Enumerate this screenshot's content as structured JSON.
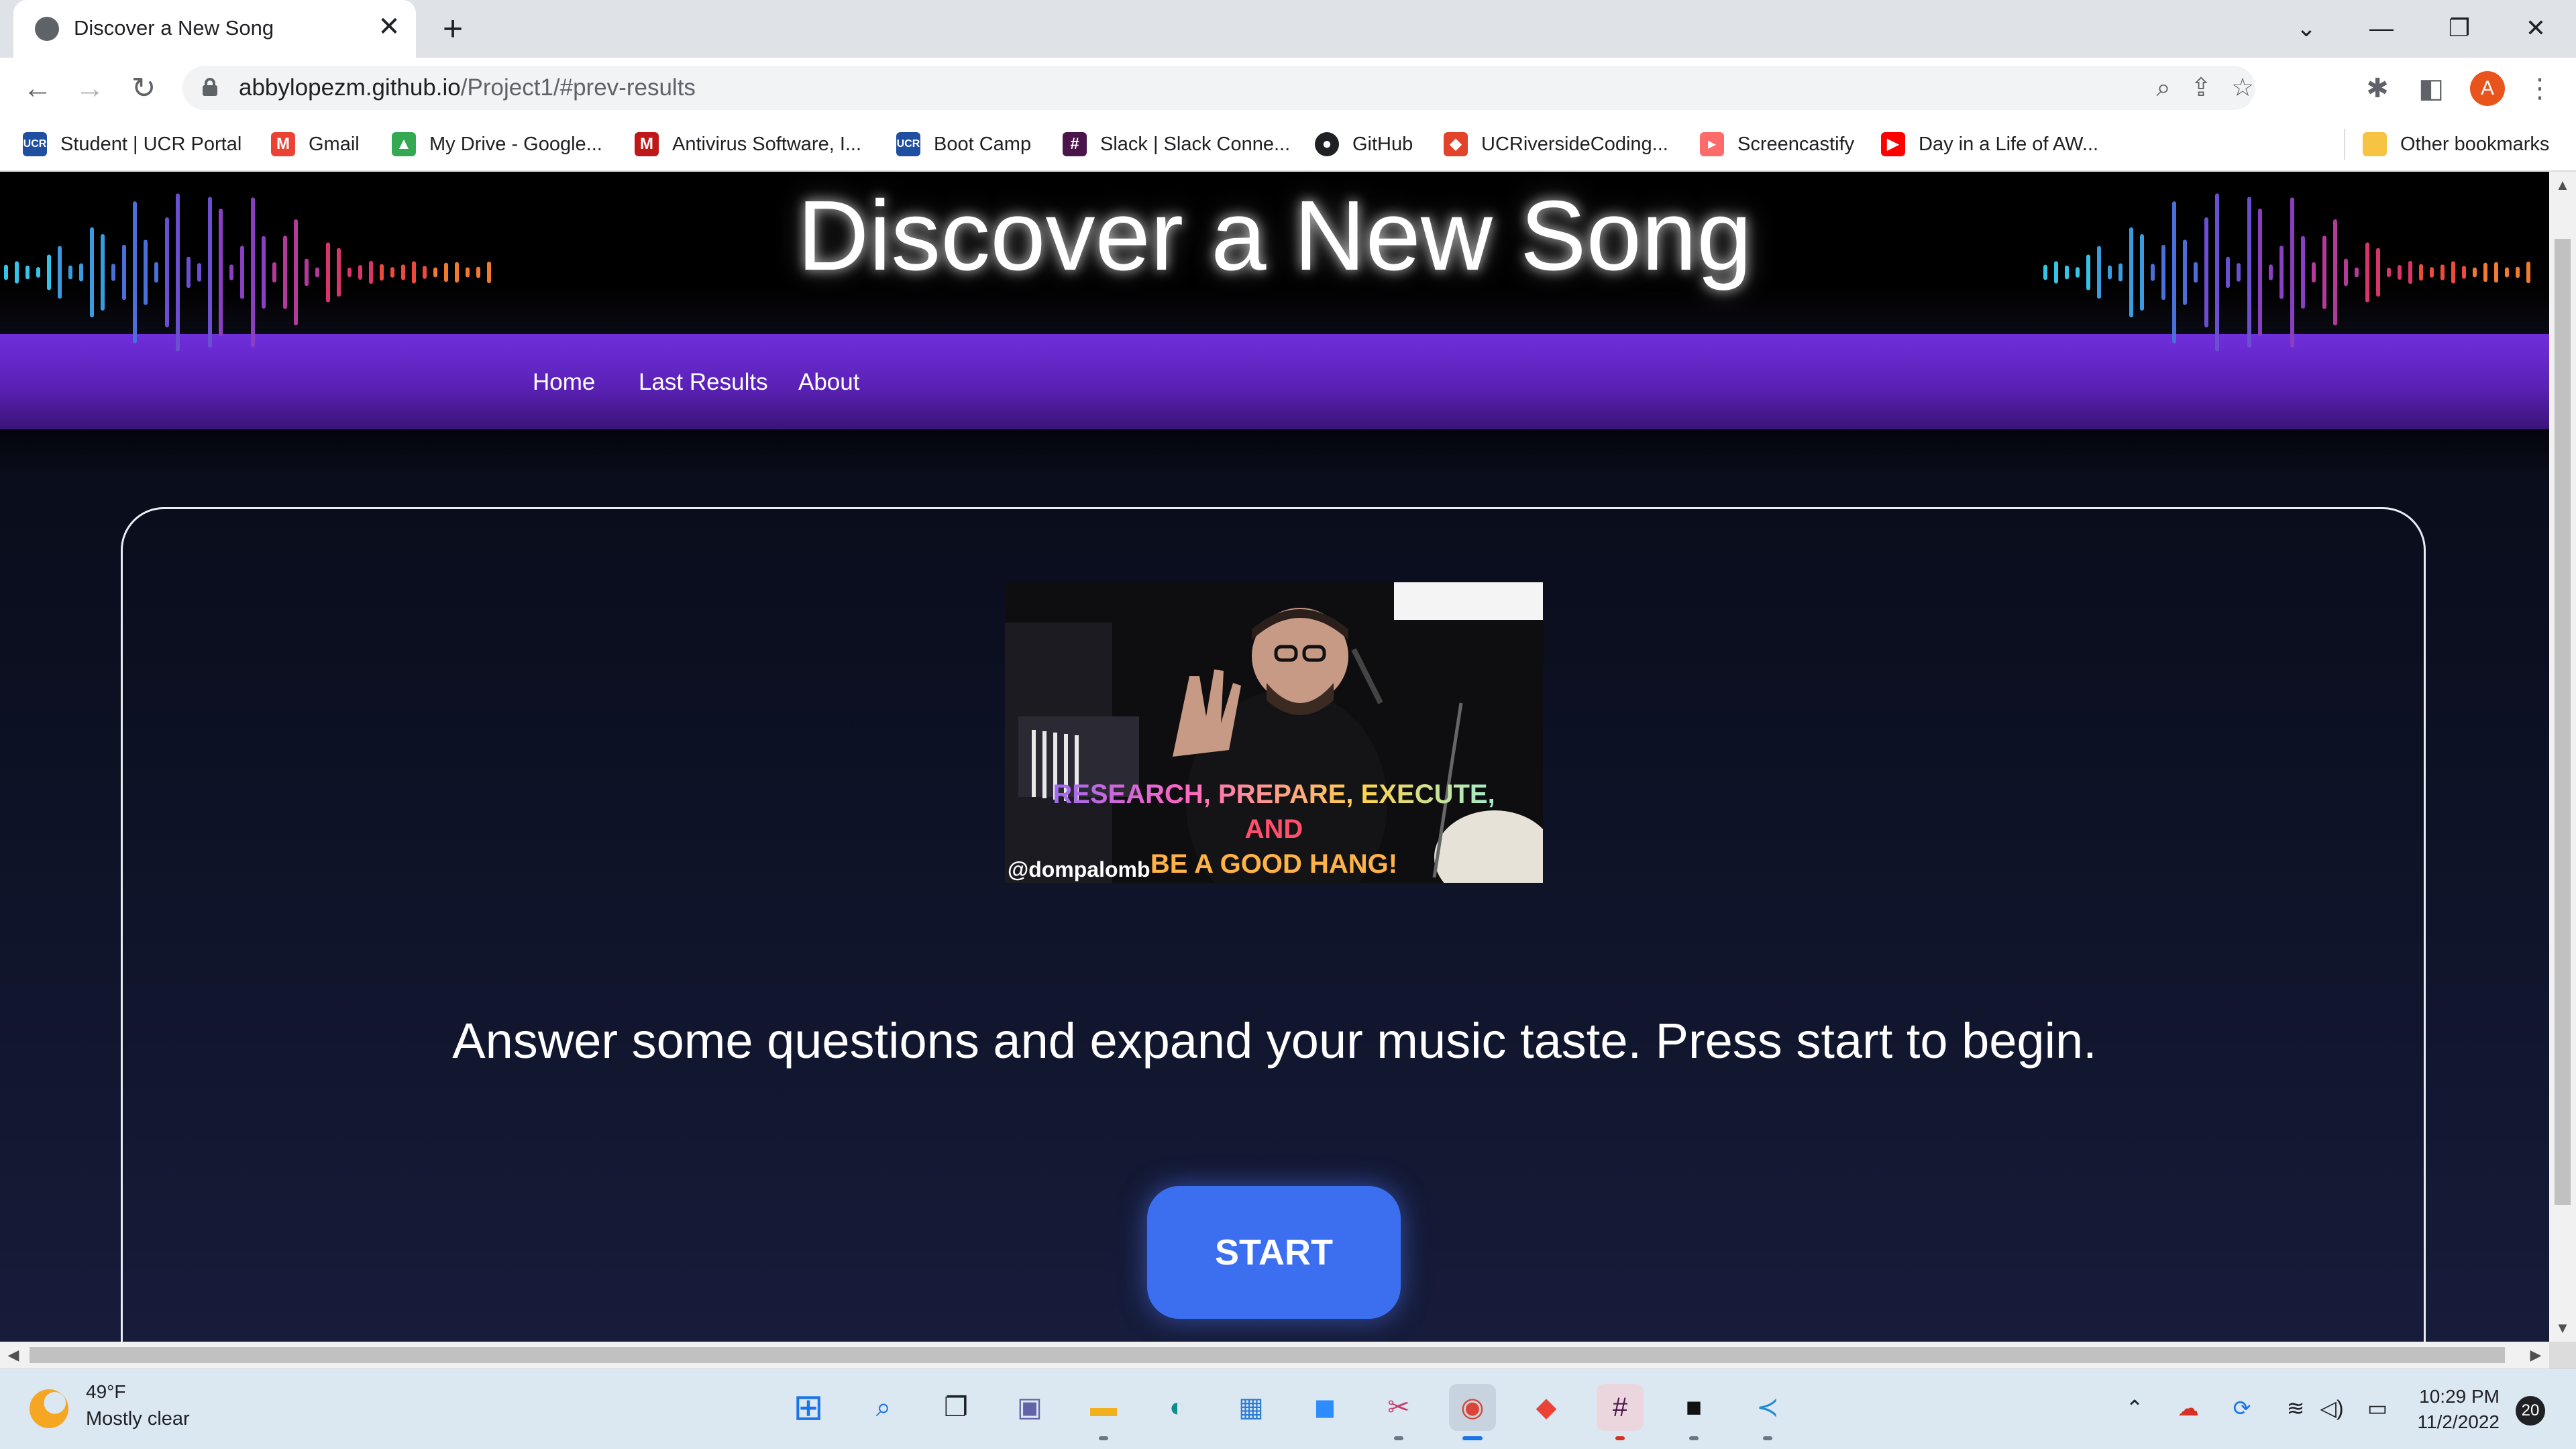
{
  "browser": {
    "tab_title": "Discover a New Song",
    "tab_close": "✕",
    "new_tab": "+",
    "url_host": "abbylopezm.github.io",
    "url_path": "/Project1/#prev-results",
    "profile_initial": "A"
  },
  "bookmarks": [
    {
      "label": "Student | UCR Portal",
      "icon": "ucr-icon",
      "color": "#1f4fa0"
    },
    {
      "label": "Gmail",
      "icon": "gmail-icon",
      "color": "#ea4335"
    },
    {
      "label": "My Drive - Google...",
      "icon": "drive-icon",
      "color": "#34a853"
    },
    {
      "label": "Antivirus Software, I...",
      "icon": "mcafee-icon",
      "color": "#c01818"
    },
    {
      "label": "Boot Camp",
      "icon": "ucr-icon",
      "color": "#1f4fa0"
    },
    {
      "label": "Slack | Slack Conne...",
      "icon": "slack-icon",
      "color": "#4a154b"
    },
    {
      "label": "GitHub",
      "icon": "github-icon",
      "color": "#202124"
    },
    {
      "label": "UCRiversideCoding...",
      "icon": "gitlab-icon",
      "color": "#e2432a"
    },
    {
      "label": "Screencastify",
      "icon": "screencastify-icon",
      "color": "#ff6b6b"
    },
    {
      "label": "Day in a Life of AW...",
      "icon": "youtube-icon",
      "color": "#ff0000"
    },
    {
      "label": "Other bookmarks",
      "icon": "folder-icon",
      "color": "#f6c343"
    }
  ],
  "site": {
    "title": "Discover a New Song",
    "nav": [
      "Home",
      "Last Results",
      "About"
    ],
    "gif_caption_line1": "RESEARCH, PREPARE, EXECUTE,",
    "gif_caption_line2": "AND",
    "gif_caption_line3": "BE A GOOD HANG!",
    "gif_handle": "@dompalomb",
    "tagline": "Answer some questions and expand your music taste. Press start to begin.",
    "start_label": "START"
  },
  "taskbar": {
    "temperature": "49°F",
    "weather": "Mostly clear",
    "time": "10:29 PM",
    "date": "11/2/2022",
    "notifications": "20"
  },
  "colors": {
    "nav_purple": "#6f2fdc",
    "start_button": "#3b6ff0"
  }
}
